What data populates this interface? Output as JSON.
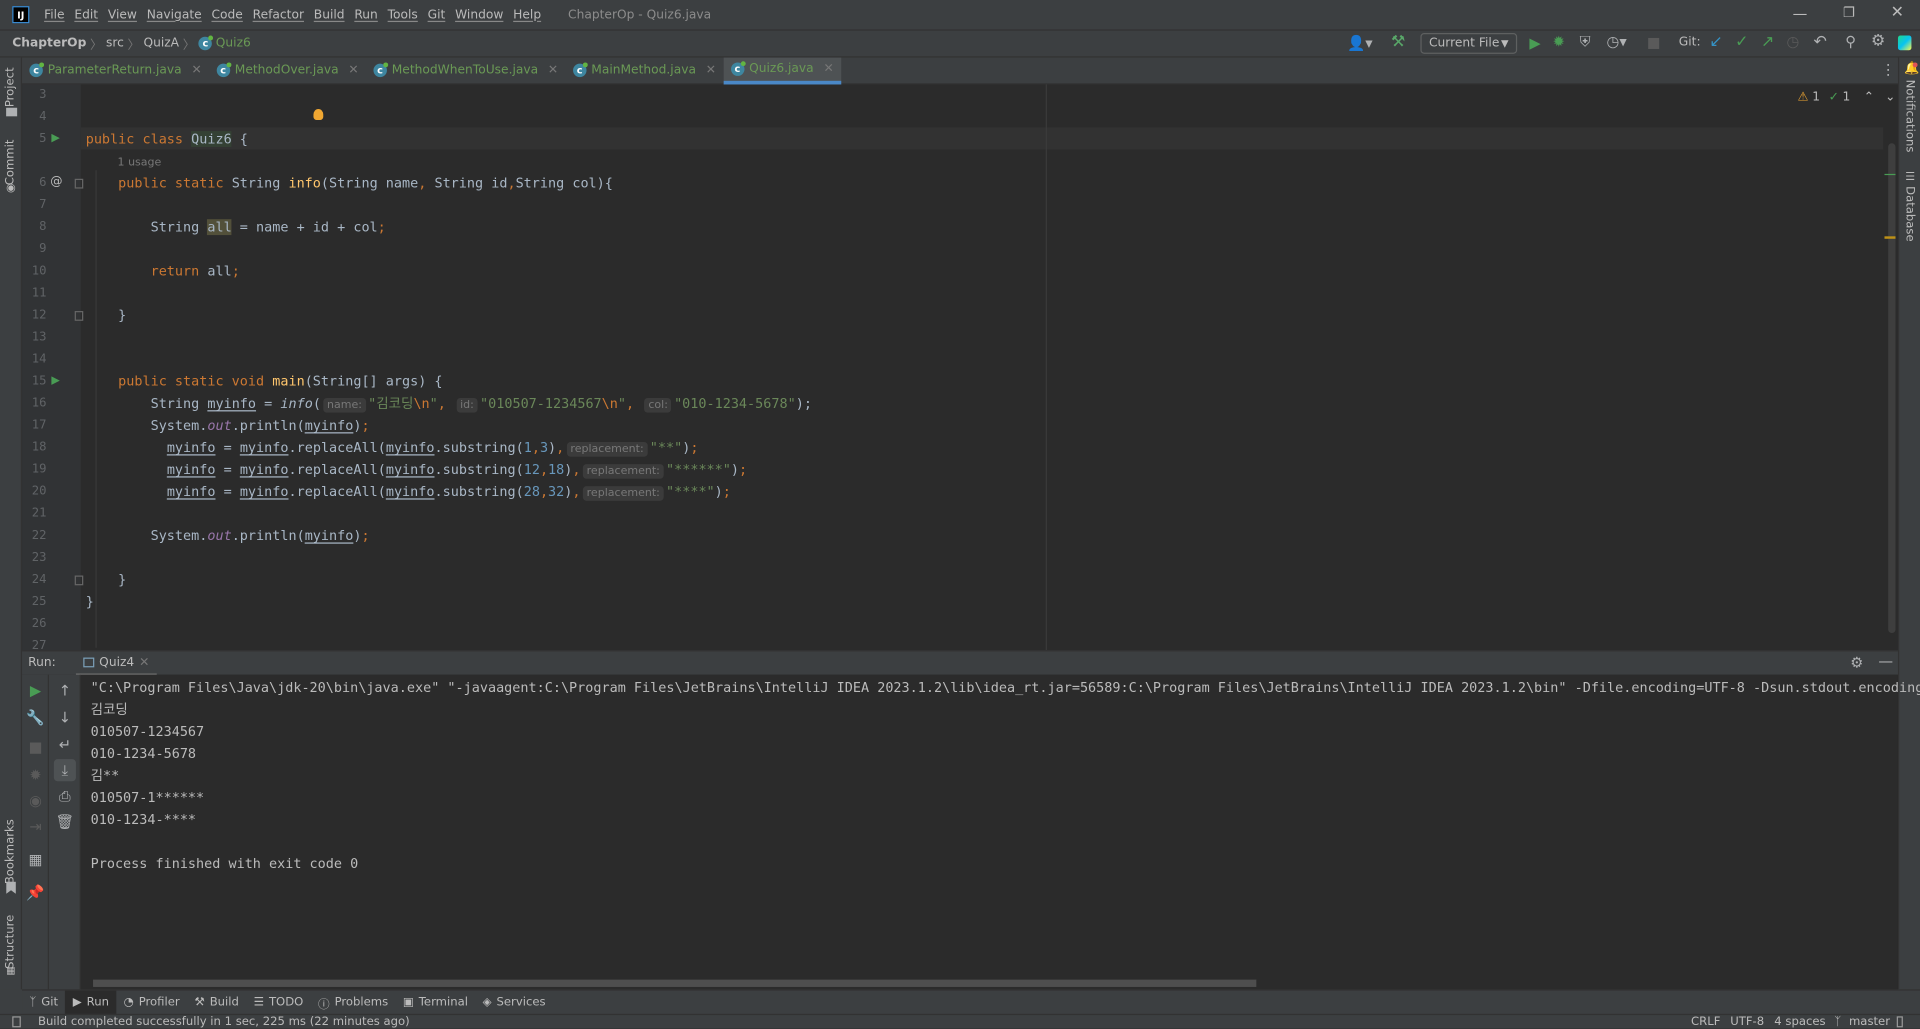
{
  "window": {
    "title": "ChapterOp - Quiz6.java",
    "app_icon": "IJ",
    "controls": [
      "minimize",
      "restore",
      "close"
    ]
  },
  "menu": [
    "File",
    "Edit",
    "View",
    "Navigate",
    "Code",
    "Refactor",
    "Build",
    "Run",
    "Tools",
    "Git",
    "Window",
    "Help"
  ],
  "breadcrumb": [
    "ChapterOp",
    "src",
    "QuizA",
    "Quiz6"
  ],
  "toolbar": {
    "run_config": "Current File",
    "git_label": "Git:"
  },
  "tabs": [
    {
      "label": "ParameterReturn.java"
    },
    {
      "label": "MethodOver.java"
    },
    {
      "label": "MethodWhenToUse.java"
    },
    {
      "label": "MainMethod.java"
    },
    {
      "label": "Quiz6.java",
      "active": true
    }
  ],
  "inspections": {
    "warnings": "1",
    "weak_warnings": "1"
  },
  "left_stripe": [
    "Project",
    "Commit",
    "Bookmarks",
    "Structure"
  ],
  "right_stripe": [
    "Notifications",
    "Database"
  ],
  "editor": {
    "lines": [
      {
        "no": "3",
        "tokens": []
      },
      {
        "no": "4",
        "tokens": []
      },
      {
        "no": "5",
        "tokens": [
          [
            "public class ",
            "k"
          ],
          [
            "Quiz6",
            "cls"
          ],
          [
            " {",
            "p"
          ]
        ]
      },
      {
        "no": "",
        "usage": "1 usage"
      },
      {
        "no": "6",
        "tokens": [
          [
            "    public static ",
            "k"
          ],
          [
            "String ",
            "p"
          ],
          [
            "info",
            "f"
          ],
          [
            "(String name",
            "p"
          ],
          [
            ", ",
            "k"
          ],
          [
            "String id",
            "p"
          ],
          [
            ",",
            "k"
          ],
          [
            "String col){",
            "p"
          ]
        ]
      },
      {
        "no": "7",
        "tokens": []
      },
      {
        "no": "8",
        "tokens": [
          [
            "        String ",
            "p"
          ],
          [
            "all",
            "hl"
          ],
          [
            " = name + id + col",
            "p"
          ],
          [
            ";",
            "k"
          ]
        ]
      },
      {
        "no": "9",
        "tokens": []
      },
      {
        "no": "10",
        "tokens": [
          [
            "        return ",
            "k"
          ],
          [
            "all",
            "p"
          ],
          [
            ";",
            "k"
          ]
        ]
      },
      {
        "no": "11",
        "tokens": []
      },
      {
        "no": "12",
        "tokens": [
          [
            "    }",
            "p"
          ]
        ]
      },
      {
        "no": "13",
        "tokens": []
      },
      {
        "no": "14",
        "tokens": []
      },
      {
        "no": "15",
        "tokens": [
          [
            "    public static void ",
            "k"
          ],
          [
            "main",
            "f"
          ],
          [
            "(String[] args) {",
            "p"
          ]
        ]
      },
      {
        "no": "16",
        "tokens": [
          [
            "        String ",
            "p"
          ],
          [
            "myinfo",
            "u"
          ],
          [
            " = ",
            "p"
          ],
          [
            "info",
            "it"
          ],
          [
            "(",
            "p"
          ],
          [
            "name:",
            "hint"
          ],
          [
            "\"김코딩",
            "s"
          ],
          [
            "\\n",
            "esc"
          ],
          [
            "\"",
            "s"
          ],
          [
            ", ",
            "k"
          ],
          [
            "id:",
            "hint"
          ],
          [
            "\"010507-1234567",
            "s"
          ],
          [
            "\\n",
            "esc"
          ],
          [
            "\"",
            "s"
          ],
          [
            ", ",
            "k"
          ],
          [
            "col:",
            "hint"
          ],
          [
            "\"010-1234-5678\"",
            "s"
          ],
          [
            ");",
            "p"
          ]
        ]
      },
      {
        "no": "17",
        "tokens": [
          [
            "        System.",
            "p"
          ],
          [
            "out",
            "o"
          ],
          [
            ".println(",
            "p"
          ],
          [
            "myinfo",
            "u"
          ],
          [
            ")",
            "p"
          ],
          [
            ";",
            "k"
          ]
        ]
      },
      {
        "no": "18",
        "tokens": [
          [
            "          ",
            "p"
          ],
          [
            "myinfo",
            "u"
          ],
          [
            " = ",
            "p"
          ],
          [
            "myinfo",
            "u"
          ],
          [
            ".replaceAll(",
            "p"
          ],
          [
            "myinfo",
            "u"
          ],
          [
            ".substring(",
            "p"
          ],
          [
            "1",
            "n"
          ],
          [
            ",",
            "k"
          ],
          [
            "3",
            "n"
          ],
          [
            ")",
            "p"
          ],
          [
            ",",
            "k"
          ],
          [
            "replacement:",
            "hint"
          ],
          [
            "\"**\"",
            "s"
          ],
          [
            ")",
            "p"
          ],
          [
            ";",
            "k"
          ]
        ]
      },
      {
        "no": "19",
        "tokens": [
          [
            "          ",
            "p"
          ],
          [
            "myinfo",
            "u"
          ],
          [
            " = ",
            "p"
          ],
          [
            "myinfo",
            "u"
          ],
          [
            ".replaceAll(",
            "p"
          ],
          [
            "myinfo",
            "u"
          ],
          [
            ".substring(",
            "p"
          ],
          [
            "12",
            "n"
          ],
          [
            ",",
            "k"
          ],
          [
            "18",
            "n"
          ],
          [
            ")",
            "p"
          ],
          [
            ",",
            "k"
          ],
          [
            "replacement:",
            "hint"
          ],
          [
            "\"******\"",
            "s"
          ],
          [
            ")",
            "p"
          ],
          [
            ";",
            "k"
          ]
        ]
      },
      {
        "no": "20",
        "tokens": [
          [
            "          ",
            "p"
          ],
          [
            "myinfo",
            "u"
          ],
          [
            " = ",
            "p"
          ],
          [
            "myinfo",
            "u"
          ],
          [
            ".replaceAll(",
            "p"
          ],
          [
            "myinfo",
            "u"
          ],
          [
            ".substring(",
            "p"
          ],
          [
            "28",
            "n"
          ],
          [
            ",",
            "k"
          ],
          [
            "32",
            "n"
          ],
          [
            ")",
            "p"
          ],
          [
            ",",
            "k"
          ],
          [
            "replacement:",
            "hint"
          ],
          [
            "\"****\"",
            "s"
          ],
          [
            ")",
            "p"
          ],
          [
            ";",
            "k"
          ]
        ]
      },
      {
        "no": "21",
        "tokens": []
      },
      {
        "no": "22",
        "tokens": [
          [
            "        System.",
            "p"
          ],
          [
            "out",
            "o"
          ],
          [
            ".println(",
            "p"
          ],
          [
            "myinfo",
            "u"
          ],
          [
            ")",
            "p"
          ],
          [
            ";",
            "k"
          ]
        ]
      },
      {
        "no": "23",
        "tokens": []
      },
      {
        "no": "24",
        "tokens": [
          [
            "    }",
            "p"
          ]
        ]
      },
      {
        "no": "25",
        "tokens": [
          [
            "}",
            "p"
          ]
        ]
      },
      {
        "no": "26",
        "tokens": []
      },
      {
        "no": "27",
        "tokens": []
      }
    ]
  },
  "run": {
    "label": "Run:",
    "tab": "Quiz4",
    "output": [
      "\"C:\\Program Files\\Java\\jdk-20\\bin\\java.exe\" \"-javaagent:C:\\Program Files\\JetBrains\\IntelliJ IDEA 2023.1.2\\lib\\idea_rt.jar=56589:C:\\Program Files\\JetBrains\\IntelliJ IDEA 2023.1.2\\bin\" -Dfile.encoding=UTF-8 -Dsun.stdout.encoding",
      "김코딩",
      "010507-1234567",
      "010-1234-5678",
      "김**",
      "010507-1******",
      "010-1234-****",
      "",
      "Process finished with exit code 0"
    ]
  },
  "bottom_tools": [
    {
      "label": "Git",
      "icon": "git-branch"
    },
    {
      "label": "Run",
      "icon": "play",
      "active": true
    },
    {
      "label": "Profiler",
      "icon": "profiler"
    },
    {
      "label": "Build",
      "icon": "hammer"
    },
    {
      "label": "TODO",
      "icon": "list"
    },
    {
      "label": "Problems",
      "icon": "info"
    },
    {
      "label": "Terminal",
      "icon": "terminal"
    },
    {
      "label": "Services",
      "icon": "services"
    }
  ],
  "status": {
    "message": "Build completed successfully in 1 sec, 225 ms (22 minutes ago)",
    "line_sep": "CRLF",
    "encoding": "UTF-8",
    "indent": "4 spaces",
    "branch": "master"
  }
}
